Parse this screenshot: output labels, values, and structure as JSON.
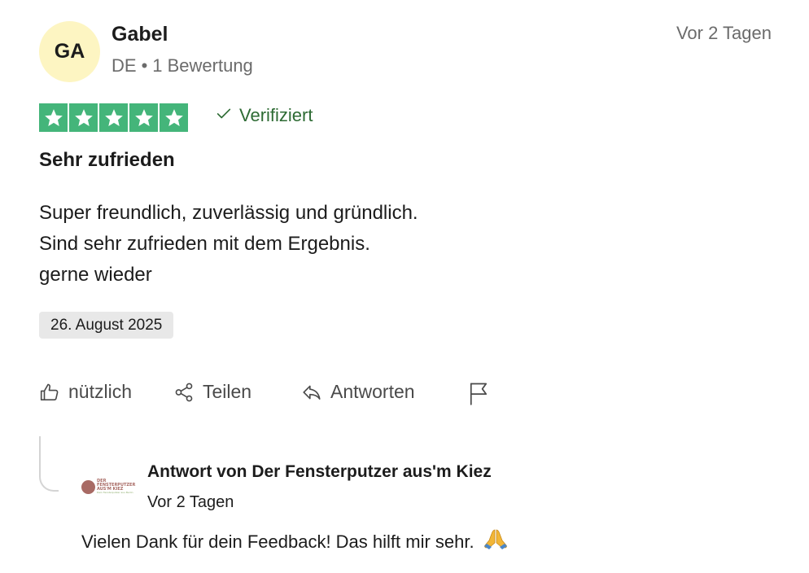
{
  "review": {
    "author": {
      "initials": "GA",
      "name": "Gabel",
      "country": "DE",
      "separator": "•",
      "review_count": "1 Bewertung"
    },
    "date_ago": "Vor 2 Tagen",
    "rating": 5,
    "verified_label": "Verifiziert",
    "title": "Sehr zufrieden",
    "body_lines": [
      "Super freundlich, zuverlässig und gründlich.",
      "Sind sehr zufrieden mit dem Ergebnis.",
      "gerne wieder"
    ],
    "experience_date": "26. August 2025"
  },
  "actions": {
    "useful_label": "nützlich",
    "share_label": "Teilen",
    "reply_label": "Antworten"
  },
  "reply": {
    "logo_text_lines": [
      "DER",
      "FENSTERPUTZER",
      "AUS'M KIEZ"
    ],
    "logo_tagline": "Dein Fensterputzer aus Berlin",
    "title": "Antwort von Der Fensterputzer aus'm Kiez",
    "date": "Vor 2 Tagen",
    "body": "Vielen Dank für dein Feedback! Das hilft mir sehr."
  },
  "colors": {
    "star_green": "#44b57a",
    "verified_green": "#2e6b34",
    "avatar_bg": "#fdf5c2",
    "badge_bg": "#e8e8e8"
  },
  "icons": {
    "star": "star-icon",
    "check": "check-icon",
    "thumbs_up": "thumbs-up-icon",
    "share": "share-icon",
    "reply": "reply-arrow-icon",
    "flag": "flag-icon",
    "emoji": "folded-hands-emoji-icon"
  }
}
